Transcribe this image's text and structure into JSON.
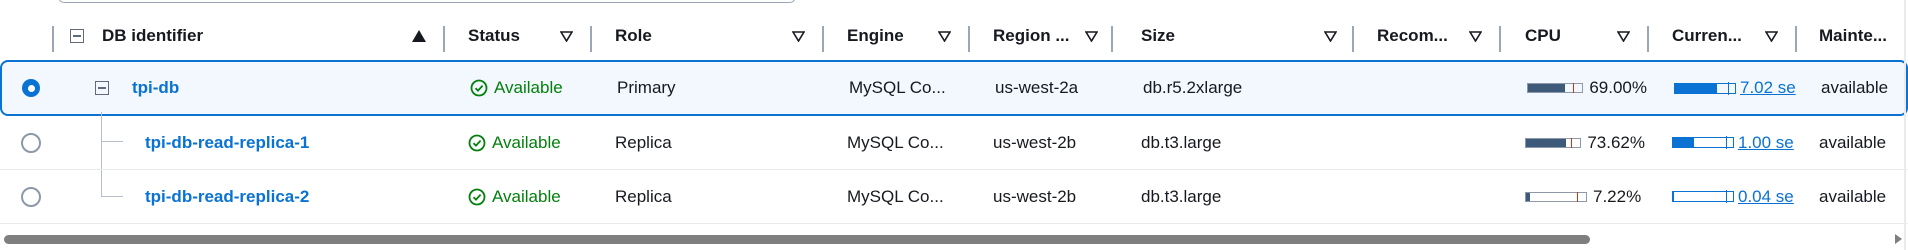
{
  "columns": [
    {
      "label": "DB identifier",
      "sort": "ascending"
    },
    {
      "label": "Status"
    },
    {
      "label": "Role"
    },
    {
      "label": "Engine"
    },
    {
      "label": "Region ..."
    },
    {
      "label": "Size"
    },
    {
      "label": "Recom..."
    },
    {
      "label": "CPU"
    },
    {
      "label": "Curren..."
    },
    {
      "label": "Mainte..."
    }
  ],
  "rows": [
    {
      "selected": true,
      "db_identifier": "tpi-db",
      "status": "Available",
      "role": "Primary",
      "engine": "MySQL Co...",
      "region": "us-west-2a",
      "size": "db.r5.2xlarge",
      "recommendations": "",
      "cpu": "69.00%",
      "cpu_fraction": 0.69,
      "current_activity": "7.02 se",
      "activity_fraction": 0.7,
      "maintenance": "available"
    },
    {
      "selected": false,
      "db_identifier": "tpi-db-read-replica-1",
      "status": "Available",
      "role": "Replica",
      "engine": "MySQL Co...",
      "region": "us-west-2b",
      "size": "db.t3.large",
      "recommendations": "",
      "cpu": "73.62%",
      "cpu_fraction": 0.7362,
      "current_activity": "1.00 se",
      "activity_fraction": 0.35,
      "maintenance": "available"
    },
    {
      "selected": false,
      "db_identifier": "tpi-db-read-replica-2",
      "status": "Available",
      "role": "Replica",
      "engine": "MySQL Co...",
      "region": "us-west-2b",
      "size": "db.t3.large",
      "recommendations": "",
      "cpu": "7.22%",
      "cpu_fraction": 0.0722,
      "current_activity": "0.04 se",
      "activity_fraction": 0.02,
      "maintenance": "available"
    }
  ],
  "colors": {
    "accent": "#0972d3",
    "status_green": "#037f0c",
    "cpu_bar": "#3d5a7a",
    "threshold_red": "#d13212"
  }
}
